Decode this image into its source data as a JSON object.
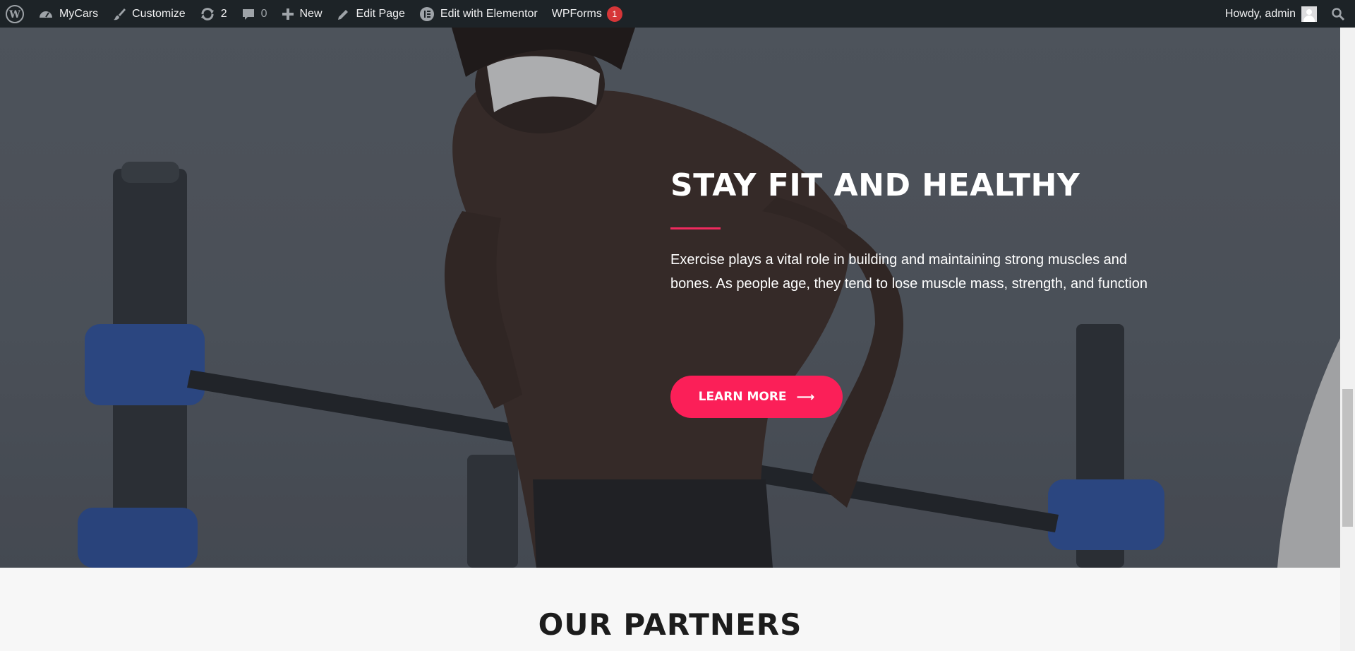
{
  "adminbar": {
    "site_name": "MyCars",
    "customize": "Customize",
    "updates_count": "2",
    "comments_count": "0",
    "new_label": "New",
    "edit_page": "Edit Page",
    "edit_elementor": "Edit with Elementor",
    "wpforms": "WPForms",
    "wpforms_count": "1",
    "howdy": "Howdy, admin"
  },
  "hero": {
    "title": "STAY FIT AND HEALTHY",
    "text": "Exercise plays a vital role in building and maintaining strong muscles and bones. As people age, they tend to lose muscle mass, strength, and function",
    "cta_label": "LEARN MORE",
    "cta_arrow": "⟶",
    "accent_color": "#fb1f58"
  },
  "partners": {
    "title": "OUR PARTNERS"
  },
  "icons": [
    "wordpress-icon",
    "dashboard-icon",
    "paintbrush-icon",
    "updates-icon",
    "comment-icon",
    "plus-icon",
    "pencil-icon",
    "elementor-icon",
    "search-icon",
    "user-avatar-icon",
    "arrow-right-icon"
  ]
}
